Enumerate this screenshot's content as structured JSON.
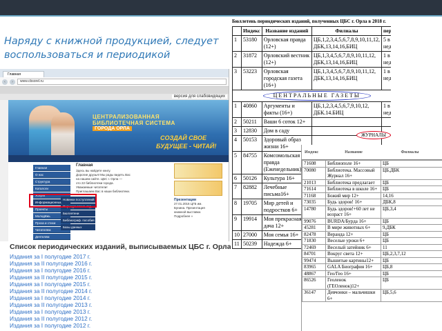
{
  "slide": {
    "title": "Наряду с книжной продукцией, следует воспользоваться и периодикой"
  },
  "browser": {
    "tab_label": "Главная",
    "url": "www.cbsorel.ru",
    "visually_impaired_link": "версия для слабовидящих",
    "banner_line1": "ЦЕНТРАЛИЗОВАННАЯ",
    "banner_line2": "БИБЛИОТЕЧНАЯ СИСТЕМА",
    "banner_line3": "ГОРОДА ОРЛА",
    "banner_slogan1": "СОЗДАЙ СВОЕ",
    "banner_slogan2": "БУДУЩЕЕ - ЧИТАЙ!",
    "menu": [
      "Главная",
      "О нас",
      "Структура",
      "Каталоги",
      "Услуги",
      "Информационные",
      "Проекты",
      "Молодёжь",
      "Проза и стихи",
      "Читателям",
      "Деятелям"
    ],
    "submenu": [
      "Новинки поступлений",
      "Периодические изд.",
      "Бюллетени",
      "Библиограф. пособия",
      "Базы данных"
    ],
    "main_heading": "Главная",
    "main_lines": [
      "Здесь вы найдете книгу.",
      "Дорогие друзья! Мы рады видеть Вас",
      "на нашем сайте. ЦБС г. Орла —",
      "это 22 библиотеки города.",
      "Уважаемые читатели!",
      "Приглашаем Вас в наши библиотеки."
    ],
    "right_news_head": "Презентации",
    "right_news": [
      "27.01.2016 ЦГБ им.",
      "Бунина. Презентация",
      "книжной выставки.",
      "Подробнее »"
    ]
  },
  "list": {
    "title": "Список периодических изданий, выписываемых ЦБС г. Орла",
    "items": [
      "Издания за I полугодие 2017 г.",
      "Издания за II полугодие 2016 г.",
      "Издания за I полугодие 2016 г.",
      "Издания за II полугодие 2015 г.",
      "Издания за I полугодие 2015 г.",
      "Издания за II полугодие 2014 г.",
      "Издания за I полугодие 2014 г.",
      "Издания за II полугодие 2013 г.",
      "Издания за I полугодие 2013 г.",
      "Издания за II полугодие 2012 г.",
      "Издания за I полугодие 2012 г."
    ]
  },
  "bulletin": {
    "title": "Бюллетень периодических изданий, полученных ЦБС г. Орла в 2018 г.",
    "headers": [
      "",
      "Индекс",
      "Название изданий",
      "Филиалы",
      "период"
    ],
    "rows_local": [
      [
        "1",
        "53180",
        "Орловская правда (12+)",
        "ЦБ,1,2,3,4,5,6,7,8,9,10,11,12, ДБК,13,14,16,БИЦ",
        "5 в нед."
      ],
      [
        "2",
        "31872",
        "Орловский вестник (12+)",
        "ЦБ,1,3,4,5,6,7,8,9,10,11,12, ДБК,13,14,16,БИЦ",
        "1 в нед."
      ],
      [
        "3",
        "53223",
        "Орловская городская газета (16+)",
        "ЦБ,1,3,4,5,6,7,8,9,10,11,12, ДБК,13,14,16,БИЦ",
        "1 в нед."
      ]
    ],
    "central_label": "ЦЕНТРАЛЬНЫЕ ГАЗЕТЫ",
    "journals_label": "ЖУРНАЛЫ",
    "rows_central": [
      [
        "1",
        "40860",
        "Аргументы и факты (16+)",
        "ЦБ,1,2,3,4,5,6,7,9,10,12, ДБК.14.БИЦ",
        "1 в нед."
      ],
      [
        "2",
        "50211",
        "Ваши 6 соток 12+",
        "",
        ""
      ],
      [
        "3",
        "12830",
        "Дом в саду",
        "",
        ""
      ],
      [
        "4",
        "50153",
        "Здоровый образ жизни 16+",
        "",
        ""
      ],
      [
        "5",
        "84755",
        "Комсомольская правда (Еженедельник)12+",
        "",
        ""
      ],
      [
        "6",
        "50126",
        "Культура 16+",
        "",
        ""
      ],
      [
        "7",
        "82882",
        "Лечебные письма16+",
        "",
        ""
      ],
      [
        "8",
        "19705",
        "Мир детей и подростков 6+",
        "",
        ""
      ],
      [
        "9",
        "19914",
        "Моя прекрасная дача 12+",
        "",
        ""
      ],
      [
        "10",
        "27000",
        "Моя семья 16+",
        "",
        ""
      ],
      [
        "11",
        "50239",
        "Надежда 6+",
        "",
        ""
      ]
    ]
  },
  "journals": {
    "headers": [
      "Индекс",
      "Название",
      "Филиалы"
    ],
    "rows": [
      [
        "71608",
        "Библиополе 16+",
        "ЦБ"
      ],
      [
        "70080",
        "Библиотека. Массовый Журнал 16+",
        "ЦБ,ДБК"
      ],
      [
        "21013",
        "Библиотека предлагает",
        "ЦБ"
      ],
      [
        "71614",
        "Библиотека в школе 16+",
        "ЦБ"
      ],
      [
        "71168",
        "Божий мир 12+",
        "14,16"
      ],
      [
        "73035",
        "Будь здоров! 16+",
        "ДБК,8"
      ],
      [
        "14780",
        "Будь здоров!+60 лет не возраст 16+",
        "ЦБ,3,4"
      ],
      [
        "99076",
        "BURDA/Бурда 16+",
        "ЦБ"
      ],
      [
        "45281",
        "В мире животных 6+",
        "9,ДБК"
      ],
      [
        "82478",
        "Веранда 12+",
        "ЦБ"
      ],
      [
        "71830",
        "Веселые уроки 6+",
        "ЦБ"
      ],
      [
        "72469",
        "Веселый затейник 6+",
        "11"
      ],
      [
        "84701",
        "Вокруг света 12+",
        "ЦБ,2,3,7,12"
      ],
      [
        "99474",
        "Вышитые картины12+",
        "ЦБ"
      ],
      [
        "83965",
        "GALA Биография 16+",
        "ЦБ,8"
      ],
      [
        "48867",
        "Гео/Гео 16+",
        "ЦБ"
      ],
      [
        "86526",
        "Геоленок (ГЕОленок)12+",
        "ЦБ"
      ],
      [
        "36147",
        "Девчонки – мальчишки 6+",
        "ЦБ,5,6"
      ]
    ]
  }
}
